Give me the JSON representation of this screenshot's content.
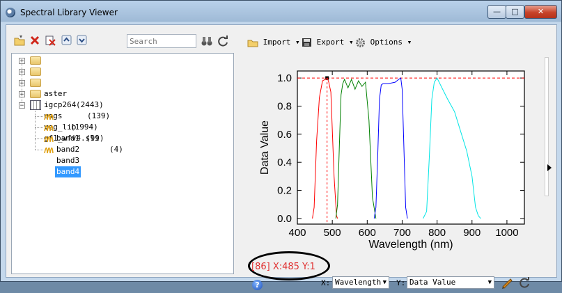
{
  "window": {
    "title": "Spectral Library Viewer"
  },
  "window_controls": {
    "minimize": "—",
    "maximize": "□",
    "close": "✕"
  },
  "toolbar": {
    "search_placeholder": "Search",
    "icons": [
      "open-folder-icon",
      "delete-icon",
      "delete-all-icon",
      "collapse-icon",
      "expand-icon",
      "binoculars-icon",
      "refresh-icon"
    ]
  },
  "tree": {
    "items": [
      {
        "name": "aster",
        "count": "(2443)"
      },
      {
        "name": "igcp264",
        "count": "(139)"
      },
      {
        "name": "usgs",
        "count": "(1994)"
      },
      {
        "name": "veg_lib",
        "count": "(99)"
      },
      {
        "name": "gf1_wfv4.sli",
        "count": "(4)"
      }
    ],
    "bands": [
      "band1",
      "band2",
      "band3",
      "band4"
    ],
    "selected": "band4"
  },
  "plot_toolbar": {
    "import": "Import",
    "export": "Export",
    "options": "Options"
  },
  "chart_data": {
    "type": "line",
    "xlabel": "Wavelength (nm)",
    "ylabel": "Data Value",
    "xlim": [
      400,
      1050
    ],
    "ylim": [
      -0.04,
      1.05
    ],
    "xticks": [
      400,
      500,
      600,
      700,
      800,
      900,
      1000
    ],
    "yticks": [
      "0.0",
      "0.2",
      "0.4",
      "0.6",
      "0.8",
      "1.0"
    ],
    "grid": false,
    "series": [
      {
        "color": "#ff0000",
        "x": [
          443,
          448,
          455,
          463,
          472,
          480,
          486,
          490,
          496,
          505,
          512,
          515
        ],
        "y": [
          0.0,
          0.08,
          0.55,
          0.86,
          0.98,
          0.99,
          1.0,
          0.97,
          0.9,
          0.3,
          0.02,
          0.0
        ]
      },
      {
        "color": "#008000",
        "x": [
          510,
          515,
          520,
          525,
          530,
          535,
          545,
          555,
          565,
          575,
          585,
          595,
          605,
          615,
          625
        ],
        "y": [
          0.0,
          0.1,
          0.5,
          0.88,
          0.96,
          0.99,
          0.93,
          0.99,
          0.92,
          0.98,
          0.94,
          0.97,
          0.7,
          0.15,
          0.0
        ]
      },
      {
        "color": "#0000ff",
        "x": [
          620,
          625,
          630,
          635,
          640,
          645,
          660,
          680,
          690,
          696,
          700,
          705,
          710,
          715
        ],
        "y": [
          0.0,
          0.08,
          0.45,
          0.85,
          0.95,
          0.96,
          0.96,
          0.97,
          0.99,
          1.0,
          0.92,
          0.5,
          0.08,
          0.0
        ]
      },
      {
        "color": "#00e5e5",
        "x": [
          760,
          770,
          778,
          785,
          792,
          800,
          810,
          830,
          850,
          870,
          885,
          900,
          910,
          918,
          925
        ],
        "y": [
          0.0,
          0.05,
          0.45,
          0.85,
          0.97,
          1.0,
          0.95,
          0.85,
          0.76,
          0.6,
          0.48,
          0.3,
          0.08,
          0.02,
          0.0
        ]
      }
    ],
    "reference_line": {
      "y": 1.0,
      "color": "#ff0000",
      "style": "dashed"
    },
    "cursor_line": {
      "x": 485,
      "color": "#ff0000",
      "style": "dashed"
    }
  },
  "coord_readout": "[86] X:485 Y:1",
  "axis_selectors": {
    "x_label": "X:",
    "x_value": "Wavelength",
    "y_label": "Y:",
    "y_value": "Data Value"
  }
}
